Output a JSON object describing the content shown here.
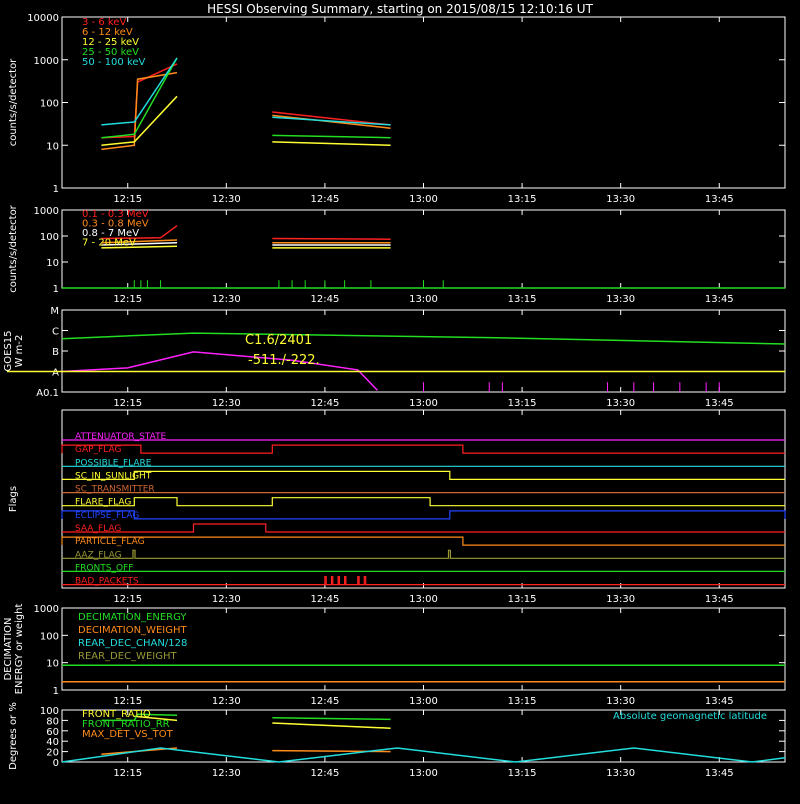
{
  "title": "HESSI Observing Summary, starting on 2015/08/15 12:10:16 UT",
  "x_ticks": [
    "12:15",
    "12:30",
    "12:45",
    "13:00",
    "13:15",
    "13:30",
    "13:45"
  ],
  "x_range_minutes": [
    725,
    835
  ],
  "colors": {
    "white": "#ffffff",
    "red": "#ff2020",
    "orange": "#ff8c1a",
    "yellow": "#ffff33",
    "green": "#22dd22",
    "cyan": "#22dddd",
    "magenta": "#ff22ff",
    "blue": "#2244ff",
    "olive": "#999933",
    "brown": "#cc6633"
  },
  "chart_data": [
    {
      "type": "line",
      "ylabel": "counts/s/detector",
      "yscale": "log",
      "ylim": [
        1,
        10000
      ],
      "yticks": [
        "1",
        "10",
        "100",
        "1000",
        "10000"
      ],
      "legend": [
        "3 - 6 keV",
        "6 - 12 keV",
        "12 - 25 keV",
        "25 - 50 keV",
        "50 - 100 keV"
      ],
      "series": [
        {
          "name": "3 - 6 keV",
          "color": "red",
          "segments": [
            [
              [
                731,
                15
              ],
              [
                736,
                16
              ],
              [
                736.5,
                300
              ],
              [
                742.5,
                800
              ]
            ],
            [
              [
                757,
                60
              ],
              [
                775,
                30
              ]
            ]
          ]
        },
        {
          "name": "6 - 12 keV",
          "color": "orange",
          "segments": [
            [
              [
                731,
                8
              ],
              [
                736,
                10
              ],
              [
                736.5,
                350
              ],
              [
                742.5,
                500
              ]
            ],
            [
              [
                757,
                50
              ],
              [
                775,
                25
              ]
            ]
          ]
        },
        {
          "name": "12 - 25 keV",
          "color": "yellow",
          "segments": [
            [
              [
                731,
                10
              ],
              [
                736,
                12
              ],
              [
                742.5,
                140
              ]
            ],
            [
              [
                757,
                12
              ],
              [
                775,
                10
              ]
            ]
          ]
        },
        {
          "name": "25 - 50 keV",
          "color": "green",
          "segments": [
            [
              [
                731,
                15
              ],
              [
                736,
                18
              ],
              [
                742.5,
                1100
              ]
            ],
            [
              [
                757,
                17
              ],
              [
                775,
                15
              ]
            ]
          ]
        },
        {
          "name": "50 - 100 keV",
          "color": "cyan",
          "segments": [
            [
              [
                731,
                30
              ],
              [
                736,
                35
              ],
              [
                742.5,
                1100
              ]
            ],
            [
              [
                757,
                45
              ],
              [
                775,
                30
              ]
            ]
          ]
        }
      ]
    },
    {
      "type": "line",
      "ylabel": "counts/s/detector",
      "yscale": "log",
      "ylim": [
        1,
        1000
      ],
      "yticks": [
        "1",
        "10",
        "100",
        "1000"
      ],
      "legend": [
        "0.1 - 0.3 MeV",
        "0.3 - 0.8 MeV",
        "0.8 - 7 MeV",
        "7 - 20 MeV"
      ],
      "series": [
        {
          "name": "0.1 - 0.3 MeV",
          "color": "red",
          "segments": [
            [
              [
                731,
                80
              ],
              [
                740,
                85
              ],
              [
                742.5,
                250
              ]
            ],
            [
              [
                757,
                80
              ],
              [
                775,
                75
              ]
            ]
          ]
        },
        {
          "name": "0.3 - 0.8 MeV",
          "color": "orange",
          "segments": [
            [
              [
                731,
                55
              ],
              [
                742.5,
                70
              ]
            ],
            [
              [
                757,
                55
              ],
              [
                775,
                55
              ]
            ]
          ]
        },
        {
          "name": "0.8 - 7 MeV",
          "color": "white",
          "segments": [
            [
              [
                731,
                45
              ],
              [
                742.5,
                55
              ]
            ],
            [
              [
                757,
                45
              ],
              [
                775,
                45
              ]
            ]
          ]
        },
        {
          "name": "7 - 20 MeV",
          "color": "yellow",
          "segments": [
            [
              [
                731,
                35
              ],
              [
                742.5,
                40
              ]
            ],
            [
              [
                757,
                35
              ],
              [
                775,
                35
              ]
            ]
          ]
        },
        {
          "name": "7 - 20 MeV",
          "color": "green",
          "segments": [
            [
              [
                725,
                1
              ],
              [
                835,
                1
              ]
            ]
          ]
        }
      ]
    },
    {
      "type": "line",
      "ylabel": "GOES15 (W m-2)",
      "ylabel_display": [
        "GOES15",
        "W m-2"
      ],
      "yscale": "log",
      "ylim": [
        1e-08,
        0.0001
      ],
      "yticks": [
        "A0.1",
        "A",
        "B",
        "C",
        "M"
      ],
      "annotations": [
        "C1.6/2401",
        "-511./-222."
      ],
      "series": [
        {
          "name": "long",
          "color": "green",
          "points": [
            [
              725,
              4e-06
            ],
            [
              745,
              7.5e-06
            ],
            [
              790,
              4.5e-06
            ],
            [
              835,
              2.2e-06
            ]
          ]
        },
        {
          "name": "short",
          "color": "magenta",
          "points": [
            [
              725,
              1e-07
            ],
            [
              735,
              1.5e-07
            ],
            [
              745,
              9e-07
            ],
            [
              760,
              3.5e-07
            ],
            [
              770,
              1.2e-07
            ],
            [
              773,
              1.2e-08
            ]
          ]
        }
      ]
    },
    {
      "type": "timeline",
      "ylabel": "Flags",
      "flags": [
        {
          "label": "ATTENUATOR_STATE",
          "color": "magenta",
          "high": []
        },
        {
          "label": "GAP_FLAG",
          "color": "red",
          "high": [
            [
              725,
              737
            ],
            [
              757,
              786
            ]
          ]
        },
        {
          "label": "POSSIBLE_FLARE",
          "color": "cyan",
          "high": []
        },
        {
          "label": "SC_IN_SUNLIGHT",
          "color": "yellow",
          "high": [
            [
              736,
              784
            ]
          ]
        },
        {
          "label": "SC_TRANSMITTER",
          "color": "brown",
          "high": []
        },
        {
          "label": "FLARE_FLAG",
          "color": "yellow",
          "high": [
            [
              736,
              742.5
            ],
            [
              757,
              781
            ]
          ]
        },
        {
          "label": "ECLIPSE_FLAG",
          "color": "blue",
          "high": [
            [
              725,
              736
            ],
            [
              784,
              835
            ]
          ]
        },
        {
          "label": "SAA_FLAG",
          "color": "red",
          "high": [
            [
              745,
              756
            ]
          ]
        },
        {
          "label": "PARTICLE_FLAG",
          "color": "orange",
          "high": [
            [
              725,
              786
            ]
          ]
        },
        {
          "label": "AAZ_FLAG",
          "color": "olive",
          "high": [
            [
              735.8,
              736.1
            ],
            [
              783.8,
              784.1
            ]
          ]
        },
        {
          "label": "FRONTS_OFF",
          "color": "green",
          "high": []
        },
        {
          "label": "BAD_PACKETS",
          "color": "red",
          "high": [
            [
              765,
              765.2
            ],
            [
              766,
              766.2
            ],
            [
              767,
              767.2
            ],
            [
              768,
              768.2
            ],
            [
              770,
              770.2
            ],
            [
              771,
              771.2
            ]
          ]
        }
      ]
    },
    {
      "type": "line",
      "ylabel": "DECIMATION ENERGY or weight",
      "ylabel_display": [
        "DECIMATION",
        "ENERGY or weight"
      ],
      "yscale": "log",
      "ylim": [
        1,
        1000
      ],
      "yticks": [
        "1",
        "10",
        "100",
        "1000"
      ],
      "legend": [
        "DECIMATION_ENERGY",
        "DECIMATION_WEIGHT",
        "REAR_DEC_CHAN/128",
        "REAR_DEC_WEIGHT"
      ],
      "series": [
        {
          "name": "DECIMATION_ENERGY",
          "color": "green",
          "points": [
            [
              725,
              8
            ],
            [
              835,
              8
            ]
          ]
        },
        {
          "name": "DECIMATION_WEIGHT",
          "color": "orange",
          "points": [
            [
              725,
              2
            ],
            [
              835,
              2
            ]
          ]
        }
      ]
    },
    {
      "type": "line",
      "ylabel": "Degrees or %",
      "yscale": "linear",
      "ylim": [
        0,
        100
      ],
      "yticks": [
        "0",
        "20",
        "40",
        "60",
        "80",
        "100"
      ],
      "legend": [
        "FRONT_RATIO",
        "FRONT_RATIO_RR",
        "MAX_DET_VS_TOT"
      ],
      "legend_right": "Absolute geomagnetic latitude",
      "series": [
        {
          "name": "FRONT_RATIO",
          "color": "yellow",
          "segments": [
            [
              [
                736,
                88
              ],
              [
                742.5,
                80
              ]
            ],
            [
              [
                757,
                75
              ],
              [
                775,
                65
              ]
            ]
          ]
        },
        {
          "name": "FRONT_RATIO_RR",
          "color": "green",
          "segments": [
            [
              [
                731,
                80
              ],
              [
                736,
                80
              ],
              [
                736.5,
                92
              ],
              [
                742.5,
                90
              ]
            ],
            [
              [
                757,
                85
              ],
              [
                775,
                82
              ]
            ]
          ]
        },
        {
          "name": "MAX_DET_VS_TOT",
          "color": "orange",
          "segments": [
            [
              [
                731,
                15
              ],
              [
                742.5,
                27
              ]
            ],
            [
              [
                757,
                22
              ],
              [
                775,
                20
              ]
            ]
          ]
        },
        {
          "name": "Absolute geomagnetic latitude",
          "color": "cyan",
          "points": [
            [
              725,
              0
            ],
            [
              740,
              27
            ],
            [
              758,
              0
            ],
            [
              776,
              27
            ],
            [
              794,
              0
            ],
            [
              812,
              27
            ],
            [
              830,
              0
            ],
            [
              835,
              8
            ]
          ]
        }
      ]
    }
  ]
}
